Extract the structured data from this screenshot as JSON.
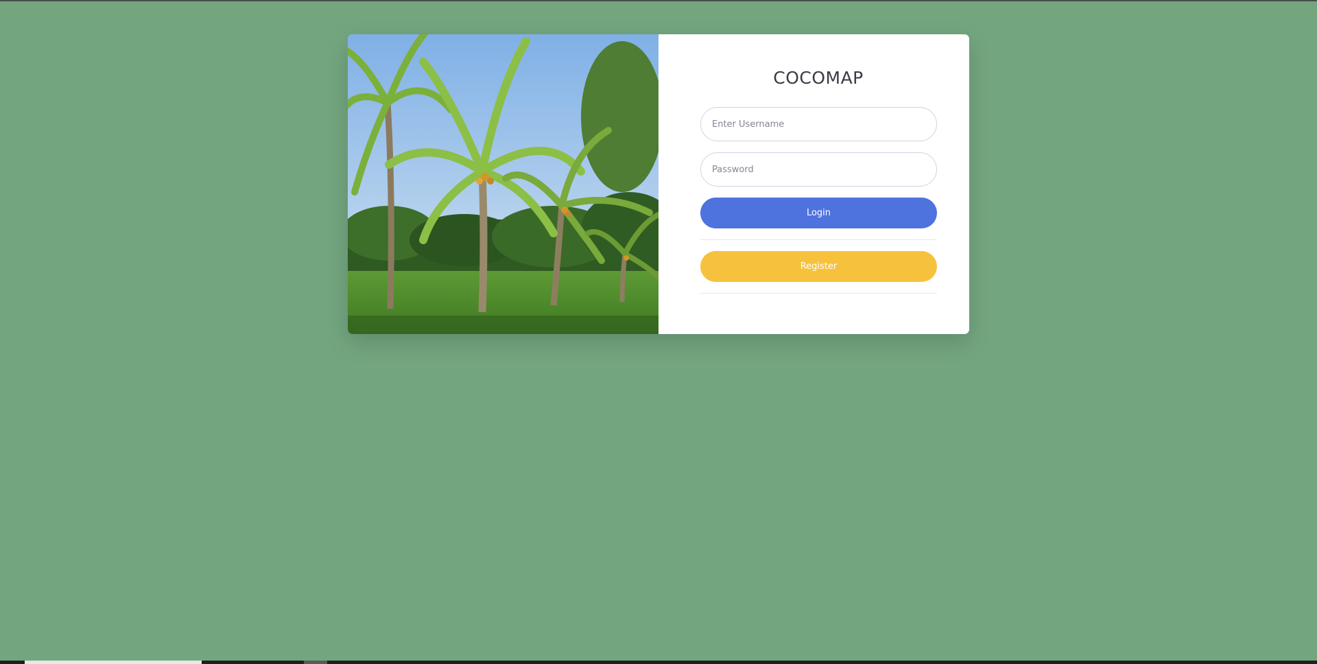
{
  "app": {
    "title": "COCOMAP"
  },
  "login_form": {
    "username_placeholder": "Enter Username",
    "password_placeholder": "Password",
    "login_label": "Login",
    "register_label": "Register"
  },
  "theme": {
    "page_background": "#73a67f",
    "login_button_color": "#4e73df",
    "register_button_color": "#f6c23e"
  },
  "image": {
    "subject": "coconut-palm-grove-photo"
  }
}
